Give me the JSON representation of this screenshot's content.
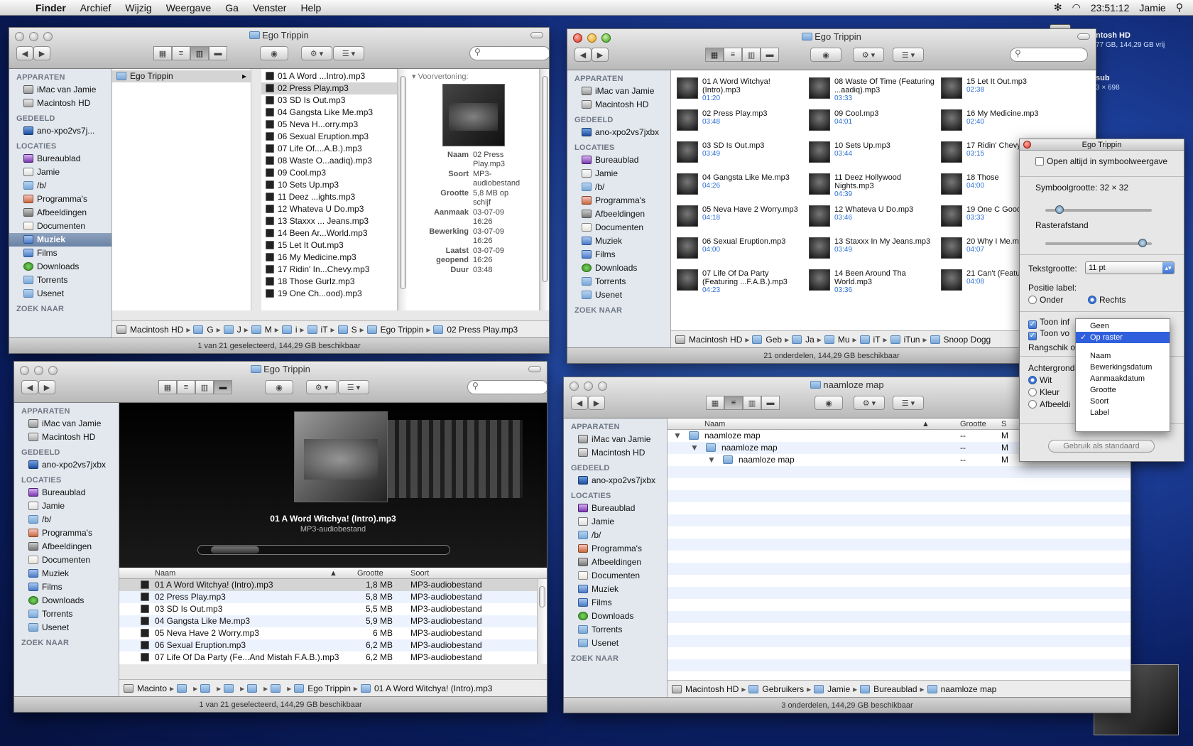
{
  "menubar": {
    "app": "Finder",
    "items": [
      "Archief",
      "Wijzig",
      "Weergave",
      "Ga",
      "Venster",
      "Help"
    ],
    "time": "23:51:12",
    "user": "Jamie"
  },
  "desktop": {
    "hd_label": "ntosh HD",
    "hd_sub": "77 GB, 144,29 GB vrij",
    "item2": "sub",
    "item2_sub": "3 × 698"
  },
  "sidebar": {
    "apparaten": "APPARATEN",
    "gedeeld": "GEDEELD",
    "locaties": "LOCATIES",
    "zoek": "ZOEK NAAR",
    "devices": [
      "iMac van Jamie",
      "Macintosh HD"
    ],
    "shared_full": "ano-xpo2vs7jxbx",
    "shared_short": "ano-xpo2vs7j...",
    "places": [
      "Bureaublad",
      "Jamie",
      "/b/",
      "Programma's",
      "Afbeeldingen",
      "Documenten",
      "Muziek",
      "Films",
      "Downloads",
      "Torrents",
      "Usenet"
    ]
  },
  "w1": {
    "title": "Ego Trippin",
    "col1": "Ego Trippin",
    "files": [
      "01 A Word ...Intro).mp3",
      "02 Press Play.mp3",
      "03 SD Is Out.mp3",
      "04 Gangsta Like Me.mp3",
      "05 Neva H...orry.mp3",
      "06 Sexual Eruption.mp3",
      "07 Life Of....A.B.).mp3",
      "08 Waste O...aadiq).mp3",
      "09 Cool.mp3",
      "10 Sets Up.mp3",
      "11 Deez ...ights.mp3",
      "12 Whateva U Do.mp3",
      "13 Staxxx ... Jeans.mp3",
      "14 Been Ar...World.mp3",
      "15 Let It Out.mp3",
      "16 My Medicine.mp3",
      "17 Ridin' In...Chevy.mp3",
      "18 Those Gurlz.mp3",
      "19 One Ch...ood).mp3"
    ],
    "preview": "Voorvertoning:",
    "meta": [
      {
        "k": "Naam",
        "v": "02 Press Play.mp3"
      },
      {
        "k": "Soort",
        "v": "MP3-audiobestand"
      },
      {
        "k": "Grootte",
        "v": "5,8 MB op schijf"
      },
      {
        "k": "Aanmaak",
        "v": "03-07-09 16:26"
      },
      {
        "k": "Bewerking",
        "v": "03-07-09 16:26"
      },
      {
        "k": "Laatst geopend",
        "v": "03-07-09 16:26"
      },
      {
        "k": "Duur",
        "v": "03:48"
      }
    ],
    "path": [
      "Macintosh HD",
      "G",
      "J",
      "M",
      "i",
      "iT",
      "S",
      "Ego Trippin",
      "02 Press Play.mp3"
    ],
    "status": "1 van 21 geselecteerd, 144,29 GB beschikbaar"
  },
  "w2": {
    "title": "Ego Trippin",
    "items": [
      {
        "n": "01 A Word Witchya! (Intro).mp3",
        "d": "01:20"
      },
      {
        "n": "02 Press Play.mp3",
        "d": "03:48"
      },
      {
        "n": "03 SD Is Out.mp3",
        "d": "03:49"
      },
      {
        "n": "04 Gangsta Like Me.mp3",
        "d": "04:26"
      },
      {
        "n": "05 Neva Have 2 Worry.mp3",
        "d": "04:18"
      },
      {
        "n": "06 Sexual Eruption.mp3",
        "d": "04:00"
      },
      {
        "n": "07 Life Of Da Party (Featuring ...F.A.B.).mp3",
        "d": "04:23"
      },
      {
        "n": "08 Waste Of Time (Featuring ...aadiq).mp3",
        "d": "03:33"
      },
      {
        "n": "09 Cool.mp3",
        "d": "04:01"
      },
      {
        "n": "10 Sets Up.mp3",
        "d": "03:44"
      },
      {
        "n": "11 Deez Hollywood Nights.mp3",
        "d": "04:39"
      },
      {
        "n": "12 Whateva U Do.mp3",
        "d": "03:46"
      },
      {
        "n": "13 Staxxx In My Jeans.mp3",
        "d": "03:49"
      },
      {
        "n": "14 Been Around Tha World.mp3",
        "d": "03:36"
      },
      {
        "n": "15 Let It Out.mp3",
        "d": "02:38"
      },
      {
        "n": "16 My Medicine.mp3",
        "d": "02:40"
      },
      {
        "n": "17 Ridin' Chevy.mp3",
        "d": "03:15"
      },
      {
        "n": "18 Those",
        "d": "04:00"
      },
      {
        "n": "19 One C Good).m",
        "d": "03:33"
      },
      {
        "n": "20 Why I Me.mp3",
        "d": "04:07"
      },
      {
        "n": "21 Can't (Featurin",
        "d": "04:08"
      }
    ],
    "path": [
      "Macintosh HD",
      "Geb",
      "Ja",
      "Mu",
      "iT",
      "iTun",
      "Snoop Dogg"
    ],
    "status": "21 onderdelen, 144,29 GB beschikbaar"
  },
  "w3": {
    "title": "Ego Trippin",
    "cover_title": "01 A Word Witchya! (Intro).mp3",
    "cover_sub": "MP3-audiobestand",
    "headers": [
      "Naam",
      "Grootte",
      "Soort"
    ],
    "rows": [
      [
        "01 A Word Witchya! (Intro).mp3",
        "1,8 MB",
        "MP3-audiobestand"
      ],
      [
        "02 Press Play.mp3",
        "5,8 MB",
        "MP3-audiobestand"
      ],
      [
        "03 SD Is Out.mp3",
        "5,5 MB",
        "MP3-audiobestand"
      ],
      [
        "04 Gangsta Like Me.mp3",
        "5,9 MB",
        "MP3-audiobestand"
      ],
      [
        "05 Neva Have 2 Worry.mp3",
        "6 MB",
        "MP3-audiobestand"
      ],
      [
        "06 Sexual Eruption.mp3",
        "6,2 MB",
        "MP3-audiobestand"
      ],
      [
        "07 Life Of Da Party (Fe...And Mistah F.A.B.).mp3",
        "6,2 MB",
        "MP3-audiobestand"
      ]
    ],
    "path": [
      "Macinto",
      "",
      "",
      "",
      "",
      "",
      "Ego Trippin",
      "01 A Word Witchya! (Intro).mp3"
    ],
    "status": "1 van 21 geselecteerd, 144,29 GB beschikbaar"
  },
  "w4": {
    "title": "naamloze map",
    "headers": [
      "Naam",
      "Grootte",
      "S"
    ],
    "rows": [
      [
        "naamloze map",
        "--",
        "M"
      ],
      [
        "naamloze map",
        "--",
        "M"
      ],
      [
        "naamloze map",
        "--",
        "M"
      ]
    ],
    "path": [
      "Macintosh HD",
      "Gebruikers",
      "Jamie",
      "Bureaublad",
      "naamloze map"
    ],
    "status": "3 onderdelen, 144,29 GB beschikbaar"
  },
  "panel": {
    "title": "Ego Trippin",
    "always": "Open altijd in symboolweergave",
    "iconsize": "Symboolgrootte: 32 × 32",
    "iconsize_value": 0.1,
    "grid": "Rasterafstand",
    "grid_value": 0.95,
    "textsize_label": "Tekstgrootte:",
    "textsize": "11 pt",
    "labelpos": "Positie label:",
    "under": "Onder",
    "right": "Rechts",
    "show1": "Toon inf",
    "show2": "Toon vo",
    "arrange": "Rangschik o",
    "bg": "Achtergrond",
    "white": "Wit",
    "color": "Kleur",
    "image": "Afbeeldi",
    "default_btn": "Gebruik als standaard"
  },
  "dropdown": {
    "items": [
      "Geen",
      "Op raster",
      "Naam",
      "Bewerkingsdatum",
      "Aanmaakdatum",
      "Grootte",
      "Soort",
      "Label"
    ],
    "selected": 1
  }
}
